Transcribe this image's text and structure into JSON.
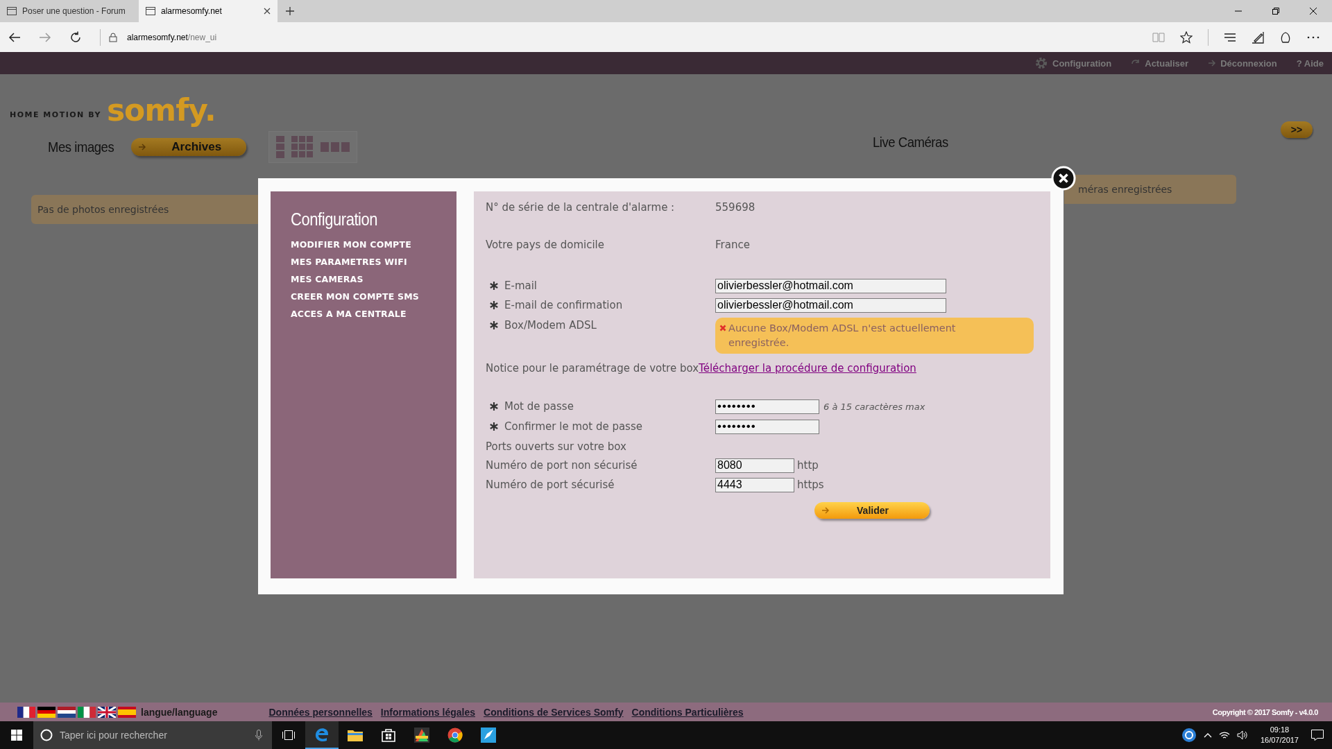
{
  "browser": {
    "tabs": [
      {
        "title": "Poser une question - Forum",
        "selected": false
      },
      {
        "title": "alarmesomfy.net",
        "selected": true
      }
    ],
    "address": {
      "host": "alarmesomfy.net",
      "path": "/new_ui"
    }
  },
  "page": {
    "top_links": [
      {
        "kind": "settings",
        "label": "Configuration"
      },
      {
        "kind": "refresh",
        "label": "Actualiser"
      },
      {
        "kind": "logout",
        "label": "Déconnexion"
      },
      {
        "kind": "plain",
        "label": "? Aide"
      }
    ],
    "logo": {
      "tagline": "HOME MOTION BY",
      "brand": "somfy."
    },
    "images": {
      "title": "Mes images",
      "button": "Archives",
      "message": "Pas de photos enregistrées"
    },
    "cameras": {
      "title": "Live Caméras",
      "expand": ">>",
      "message": "méras enregistrées"
    }
  },
  "dialog": {
    "sidebar": {
      "title": "Configuration",
      "items": [
        "MODIFIER MON COMPTE",
        "MES PARAMETRES WIFI",
        "MES CAMERAS",
        "CREER MON COMPTE SMS",
        "ACCES A MA CENTRALE"
      ]
    },
    "rows": [
      {
        "kind": "info",
        "required": false,
        "label": "N° de série de la centrale d'alarme :",
        "value": "559698"
      },
      {
        "kind": "info",
        "required": false,
        "label": "Votre pays de domicile",
        "value": "France"
      },
      {
        "kind": "input",
        "required": true,
        "label": "E-mail",
        "value": "olivierbessler@hotmail.com"
      },
      {
        "kind": "input",
        "required": true,
        "label": "E-mail de confirmation",
        "value": "olivierbessler@hotmail.com"
      },
      {
        "kind": "alert",
        "required": true,
        "label": "Box/Modem ADSL",
        "message": "Aucune Box/Modem ADSL n'est actuellement enregistrée."
      },
      {
        "kind": "link",
        "required": false,
        "label": "Notice pour le paramétrage de votre box",
        "link": "Télécharger la procédure de configuration"
      },
      {
        "kind": "password",
        "required": true,
        "label": "Mot de passe",
        "value": "••••••••",
        "hint": "6 à 15 caractères max"
      },
      {
        "kind": "password",
        "required": true,
        "label": "Confirmer le mot de passe",
        "value": "••••••••"
      },
      {
        "kind": "section",
        "required": false,
        "label": "Ports ouverts sur votre box"
      },
      {
        "kind": "port",
        "required": false,
        "label": "Numéro de port non sécurisé",
        "value": "8080",
        "suffix": "http"
      },
      {
        "kind": "port",
        "required": false,
        "label": "Numéro de port sécurisé",
        "value": "4443",
        "suffix": "https"
      }
    ],
    "submit": "Valider"
  },
  "footer": {
    "language": "langue/language",
    "links": [
      "Données personnelles",
      "Informations légales",
      "Conditions de Services Somfy",
      "Conditions Particulières"
    ],
    "copyright": "Copyright © 2017 Somfy - v4.0.0"
  },
  "taskbar": {
    "search_placeholder": "Taper ici pour rechercher",
    "time": "09:18",
    "date": "16/07/2017"
  }
}
